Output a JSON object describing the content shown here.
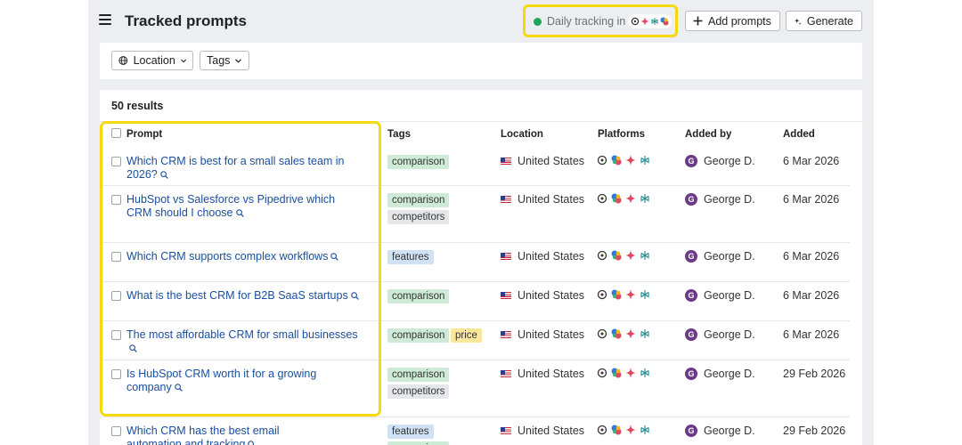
{
  "header": {
    "title": "Tracked prompts",
    "tracking_label": "Daily tracking in",
    "add_prompts_label": "Add prompts",
    "generate_label": "Generate"
  },
  "filters": {
    "location_label": "Location",
    "tags_label": "Tags"
  },
  "results_label": "50 results",
  "columns": {
    "prompt": "Prompt",
    "tags": "Tags",
    "location": "Location",
    "platforms": "Platforms",
    "added_by": "Added by",
    "added": "Added"
  },
  "rows": [
    {
      "prompt": "Which CRM is best for a small sales team in 2026?",
      "tags": [
        "comparison"
      ],
      "location": "United States",
      "added_by": "George D.",
      "avatar": "G",
      "added": "6 Mar 2026"
    },
    {
      "prompt": "HubSpot vs Salesforce vs Pipedrive which CRM should I choose",
      "tags": [
        "comparison",
        "competitors"
      ],
      "location": "United States",
      "added_by": "George D.",
      "avatar": "G",
      "added": "6 Mar 2026"
    },
    {
      "prompt": "Which CRM supports complex workflows",
      "tags": [
        "features"
      ],
      "location": "United States",
      "added_by": "George D.",
      "avatar": "G",
      "added": "6 Mar 2026"
    },
    {
      "prompt": "What is the best CRM for B2B SaaS startups",
      "tags": [
        "comparison"
      ],
      "location": "United States",
      "added_by": "George D.",
      "avatar": "G",
      "added": "6 Mar 2026"
    },
    {
      "prompt": "The most affordable CRM for small businesses",
      "tags": [
        "comparison",
        "price"
      ],
      "location": "United States",
      "added_by": "George D.",
      "avatar": "G",
      "added": "6 Mar 2026"
    },
    {
      "prompt": "Is HubSpot CRM worth it for a growing company",
      "tags": [
        "comparison",
        "competitors"
      ],
      "location": "United States",
      "added_by": "George D.",
      "avatar": "G",
      "added": "29 Feb 2026"
    },
    {
      "prompt": "Which CRM has the best email automation and tracking",
      "tags": [
        "features",
        "comparison"
      ],
      "location": "United States",
      "added_by": "George D.",
      "avatar": "G",
      "added": "29 Feb 2026"
    }
  ],
  "platform_icons": [
    "chatgpt-icon",
    "copilot-icon",
    "gemini-icon",
    "perplexity-icon"
  ],
  "colors": {
    "accent_highlight": "#f5d90a",
    "link": "#1a4fa0",
    "status_green": "#22a55a",
    "avatar": "#6b3a88",
    "tag_comparison": "#cdebd6",
    "tag_competitors": "#e6e7ea",
    "tag_features": "#cfe2f5",
    "tag_price": "#fbe79a"
  }
}
